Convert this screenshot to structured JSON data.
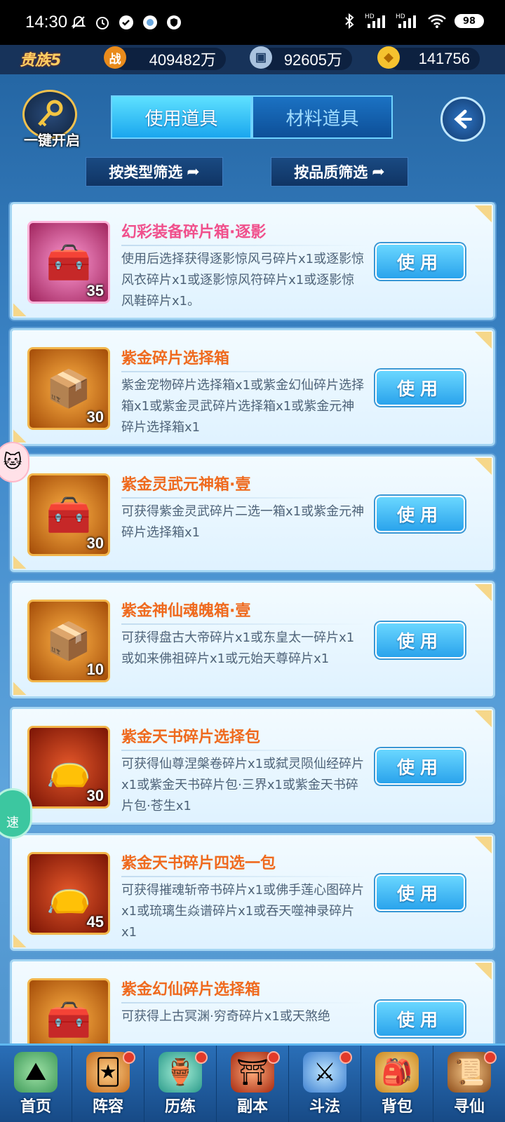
{
  "status_bar": {
    "time": "14:30",
    "left_icons": [
      "mute-icon",
      "alarm-icon",
      "app-icon",
      "app-icon",
      "shield-icon"
    ],
    "signal_label_1": "HD",
    "signal_label_2": "HD",
    "battery": "98"
  },
  "resources": {
    "vip": "贵族5",
    "combat_icon": "战",
    "combat_value": "409482万",
    "coin_value": "92605万",
    "gold_value": "141756"
  },
  "header": {
    "one_key_open": "一键开启",
    "tabs": [
      {
        "label": "使用道具",
        "active": true
      },
      {
        "label": "材料道具",
        "active": false
      }
    ],
    "back_icon": "back-arrow-icon",
    "filter_type": "按类型筛选",
    "filter_quality": "按品质筛选"
  },
  "items": [
    {
      "title": "幻彩装备碎片箱·逐影",
      "desc": "使用后选择获得逐影惊风弓碎片x1或逐影惊风衣碎片x1或逐影惊风符碎片x1或逐影惊风鞋碎片x1。",
      "count": "35",
      "button": "使用",
      "color": "#f0508c"
    },
    {
      "title": "紫金碎片选择箱",
      "desc": "紫金宠物碎片选择箱x1或紫金幻仙碎片选择箱x1或紫金灵武碎片选择箱x1或紫金元神碎片选择箱x1",
      "count": "30",
      "button": "使用",
      "color": "#ef6a1e"
    },
    {
      "title": "紫金灵武元神箱·壹",
      "desc": "可获得紫金灵武碎片二选一箱x1或紫金元神碎片选择箱x1",
      "count": "30",
      "button": "使用",
      "color": "#ef6a1e"
    },
    {
      "title": "紫金神仙魂魄箱·壹",
      "desc": "可获得盘古大帝碎片x1或东皇太一碎片x1或如来佛祖碎片x1或元始天尊碎片x1",
      "count": "10",
      "button": "使用",
      "color": "#ef6a1e"
    },
    {
      "title": "紫金天书碎片选择包",
      "desc": "可获得仙尊涅槃卷碎片x1或弑灵陨仙经碎片x1或紫金天书碎片包·三界x1或紫金天书碎片包·苍生x1",
      "count": "30",
      "button": "使用",
      "color": "#ef6a1e"
    },
    {
      "title": "紫金天书碎片四选一包",
      "desc": "可获得摧魂斩帝书碎片x1或佛手莲心图碎片x1或琉璃生焱谱碎片x1或吞天噬神录碎片x1",
      "count": "45",
      "button": "使用",
      "color": "#ef6a1e"
    },
    {
      "title": "紫金幻仙碎片选择箱",
      "desc": "可获得上古冥渊·穷奇碎片x1或天煞绝",
      "count": "",
      "button": "使用",
      "color": "#ef6a1e"
    }
  ],
  "speed_label": "速",
  "bottom_nav": [
    {
      "label": "首页",
      "icon": "home-icon",
      "dot": false
    },
    {
      "label": "阵容",
      "icon": "lineup-icon",
      "dot": true
    },
    {
      "label": "历练",
      "icon": "training-icon",
      "dot": true
    },
    {
      "label": "副本",
      "icon": "dungeon-icon",
      "dot": true
    },
    {
      "label": "斗法",
      "icon": "battle-icon",
      "dot": true
    },
    {
      "label": "背包",
      "icon": "bag-icon",
      "dot": false
    },
    {
      "label": "寻仙",
      "icon": "seek-icon",
      "dot": true
    }
  ]
}
